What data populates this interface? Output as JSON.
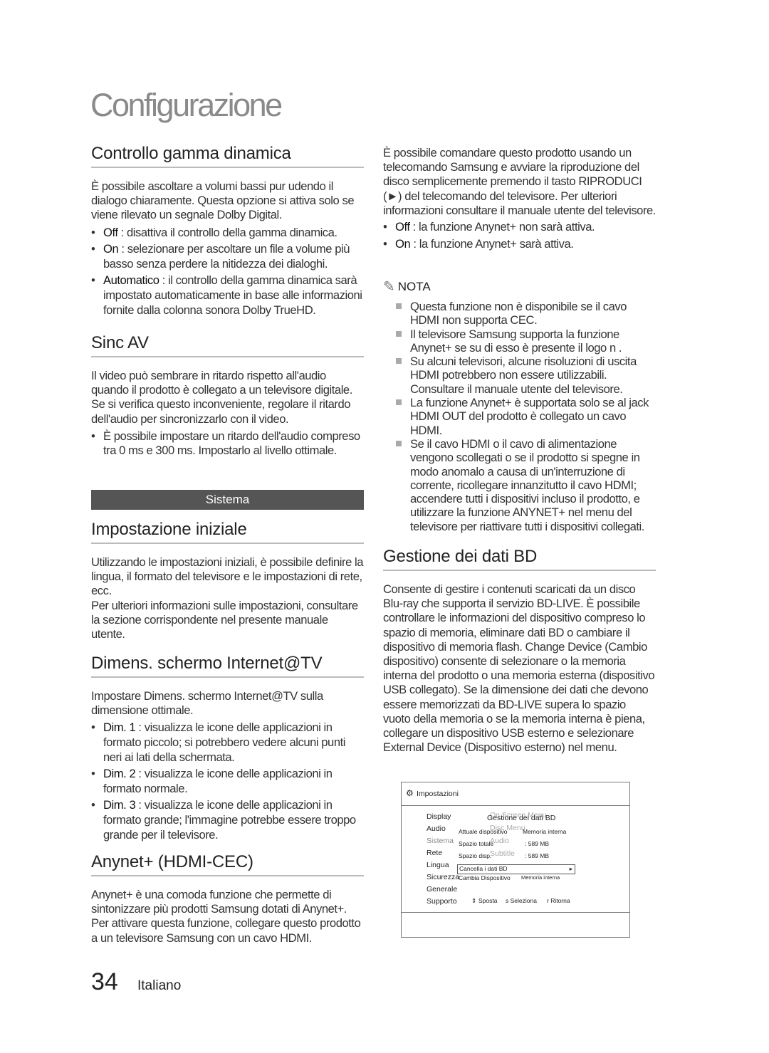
{
  "page_title": "Configurazione",
  "left": [
    {
      "heading": "Controllo gamma dinamica",
      "blocks": [
        {
          "p": "È possibile ascoltare a volumi bassi pur udendo il dialogo chiaramente. Questa opzione si attiva solo se viene rilevato un segnale Dolby Digital."
        },
        {
          "term": "Off",
          "text": " : disattiva il controllo della gamma dinamica."
        },
        {
          "term": "On",
          "text": " : selezionare per ascoltare un file a volume più basso senza perdere la nitidezza dei dialoghi."
        },
        {
          "term": "Automatico",
          "text": " : il controllo della gamma dinamica sarà impostato automaticamente in base alle informazioni fornite dalla colonna sonora Dolby TrueHD."
        }
      ]
    },
    {
      "heading": "Sinc AV",
      "blocks": [
        {
          "p": "Il video può sembrare in ritardo rispetto all'audio quando il prodotto è collegato a un televisore digitale. Se si verifica questo inconveniente, regolare il ritardo dell'audio per sincronizzarlo con il video."
        },
        {
          "term": "",
          "text": "È possibile impostare un ritardo dell'audio compreso tra 0 ms e 300 ms. Impostarlo al livello ottimale."
        }
      ]
    },
    {
      "bar": "Sistema"
    },
    {
      "heading": "Impostazione iniziale",
      "blocks": [
        {
          "p": "Utilizzando le impostazioni iniziali, è possibile definire la lingua, il formato del televisore e le impostazioni di rete, ecc."
        },
        {
          "p": "Per ulteriori informazioni sulle impostazioni, consultare la sezione corrispondente nel presente manuale utente."
        }
      ]
    },
    {
      "heading": "Dimens. schermo Internet@TV",
      "blocks": [
        {
          "p": "Impostare Dimens. schermo Internet@TV sulla dimensione ottimale."
        },
        {
          "term": "Dim. 1",
          "text": " : visualizza le icone delle applicazioni in formato piccolo; si potrebbero vedere alcuni punti neri ai lati della schermata."
        },
        {
          "term": "Dim. 2",
          "text": " : visualizza le icone delle applicazioni in formato normale."
        },
        {
          "term": "Dim. 3",
          "text": " : visualizza le icone delle applicazioni in formato grande; l'immagine potrebbe essere troppo grande per il televisore."
        }
      ]
    },
    {
      "heading": "Anynet+ (HDMI-CEC)",
      "blocks": [
        {
          "p": "Anynet+ è una comoda funzione che permette di sintonizzare più prodotti Samsung dotati di Anynet+. Per attivare questa funzione, collegare questo prodotto a un televisore Samsung con un cavo HDMI."
        }
      ]
    }
  ],
  "right": [
    {
      "blocks": [
        {
          "p": "È possibile comandare questo prodotto usando un telecomando Samsung e avviare la riproduzione del disco semplicemente premendo il tasto RIPRODUCI (►) del telecomando del televisore. Per ulteriori informazioni consultare il manuale utente del televisore."
        },
        {
          "term": "Off",
          "text": " : la funzione Anynet+ non sarà attiva."
        },
        {
          "term": "On",
          "text": " : la funzione Anynet+ sarà attiva."
        }
      ]
    },
    {
      "nota": "NOTA",
      "notes": [
        "Questa funzione non è disponibile se il cavo HDMI non supporta CEC.",
        "Il televisore Samsung supporta la funzione Anynet+ se su di esso è presente il logo n          .",
        "Su alcuni televisori, alcune risoluzioni di uscita HDMI potrebbero non essere utilizzabili. Consultare il manuale utente del televisore.",
        "La funzione Anynet+ è supportata solo se al jack HDMI OUT del prodotto è collegato un cavo HDMI.",
        "Se il cavo HDMI o il cavo di alimentazione vengono scollegati o se il prodotto si spegne in modo anomalo a causa di un'interruzione di corrente, ricollegare innanzitutto il cavo HDMI; accendere tutti i dispositivi incluso il prodotto, e utilizzare la funzione ANYNET+ nel menu del televisore per riattivare tutti i dispositivi collegati."
      ]
    },
    {
      "heading": "Gestione dei dati BD",
      "blocks": [
        {
          "p": "Consente di gestire i contenuti scaricati da un disco Blu-ray che supporta il servizio BD-LIVE. È possibile controllare le informazioni del dispositivo compreso lo spazio di memoria, eliminare dati BD o cambiare il dispositivo di memoria flash. Change Device (Cambio dispositivo) consente di selezionare o la memoria interna del prodotto o una memoria esterna (dispositivo USB collegato). Se la dimensione dei dati che devono essere memorizzati da BD-LIVE supera lo spazio vuoto della memoria o se la memoria interna è piena, collegare un dispositivo USB esterno e selezionare External Device (Dispositivo esterno) nel menu."
        }
      ]
    }
  ],
  "screen": {
    "header": "Impostazioni",
    "menu": [
      "Display",
      "Audio",
      "Sistema",
      "Rete",
      "Lingua",
      "Sicurezza",
      "Generale",
      "Supporto"
    ],
    "active_menu": "Sistema",
    "ghost": {
      "osm": "On Screen Menu",
      "disc": "Disc Menu",
      "audio": "Audio",
      "subtitle": "Subtitle"
    },
    "panel_title": "Gestione dei dati BD",
    "current_label": "Attuale dispositivo",
    "current_value": "Memoria interna",
    "total_label": "Spazio totale",
    "total_value": ": 589 MB",
    "free_label": "Spazio disp.",
    "free_value": ": 589 MB",
    "delete_label": "Cancella i dati BD",
    "change_label": "Cambia Dispositivo",
    "change_value": "Memoria interna",
    "hint_move": "Sposta",
    "hint_select": "s Seleziona",
    "hint_return": "r Ritorna"
  },
  "footer": {
    "page_number": "34",
    "language": "Italiano"
  }
}
